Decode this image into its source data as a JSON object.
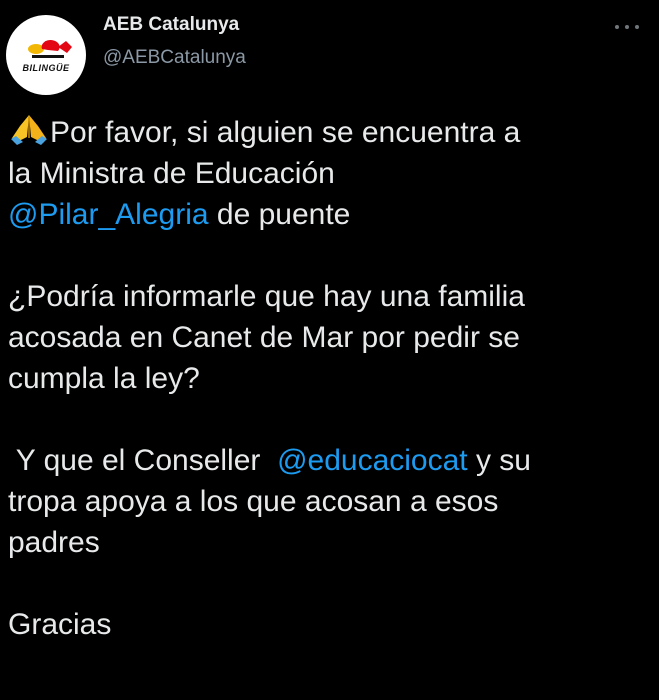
{
  "author": {
    "display_name": "AEB Catalunya",
    "handle": "@AEBCatalunya",
    "avatar_logo_text": "BILINGÜE",
    "avatar_icon": "aeb-logo"
  },
  "menu": {
    "icon": "more-horizontal-icon"
  },
  "tweet": {
    "emoji": "folded-hands-emoji",
    "line1": "Por favor, si alguien se encuentra a",
    "line2": "la Ministra de Educación",
    "line3_mention": "@Pilar_Alegria",
    "line3_rest": " de puente",
    "line4": "¿Podría informarle que hay una familia",
    "line5": "acosada en Canet de Mar por pedir se",
    "line6": "cumpla la ley?",
    "line7_pre": " Y que el Conseller  ",
    "line7_mention": "@educaciocat",
    "line7_post": " y su",
    "line8": "tropa apoya a los que acosan a esos",
    "line9": "padres",
    "line10": "Gracias"
  },
  "colors": {
    "background": "#000000",
    "text": "#e7e9ea",
    "secondary": "#8b98a5",
    "link": "#1d9bf0"
  }
}
